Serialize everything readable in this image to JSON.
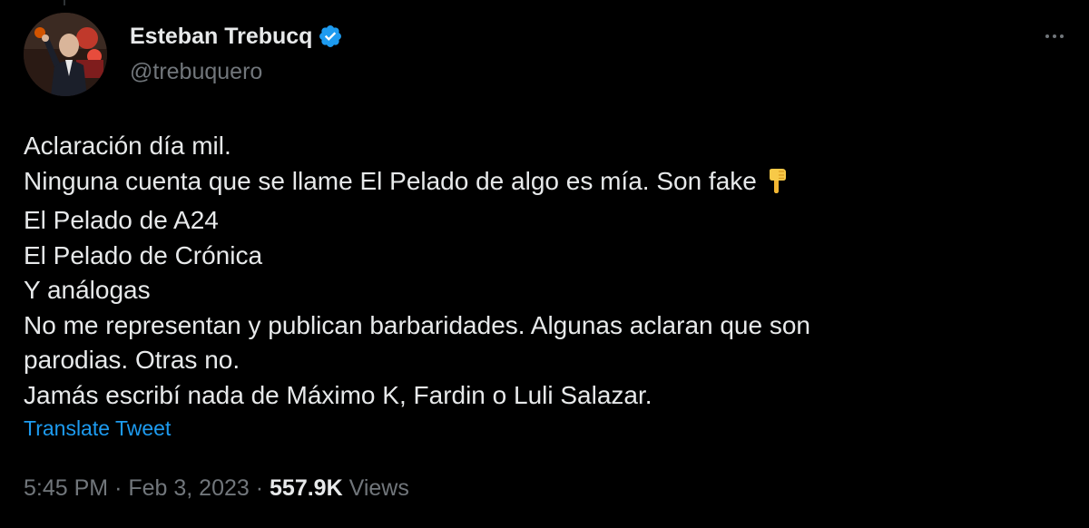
{
  "author": {
    "display_name": "Esteban Trebucq",
    "handle": "@trebuquero",
    "verified": true,
    "avatar_icon": "avatar-photo"
  },
  "menu": {
    "more_icon": "more-horizontal-icon"
  },
  "tweet": {
    "lines": [
      "Aclaración día mil.",
      "Ninguna cuenta que se llame El Pelado de algo es mía. Son fake",
      "El Pelado de A24",
      "El Pelado de Crónica",
      "Y análogas",
      "No me representan y publican barbaridades. Algunas aclaran que son",
      "parodias. Otras no.",
      "Jamás escribí nada de Máximo K, Fardin o Luli Salazar."
    ],
    "emoji": "👇",
    "translate_label": "Translate Tweet"
  },
  "meta": {
    "time": "5:45 PM",
    "separator": "·",
    "date": "Feb 3, 2023",
    "views_count": "557.9K",
    "views_label": "Views"
  },
  "colors": {
    "background": "#000000",
    "text": "#e7e9ea",
    "secondary": "#71767b",
    "link": "#1d9bf0",
    "verified": "#1d9bf0"
  }
}
